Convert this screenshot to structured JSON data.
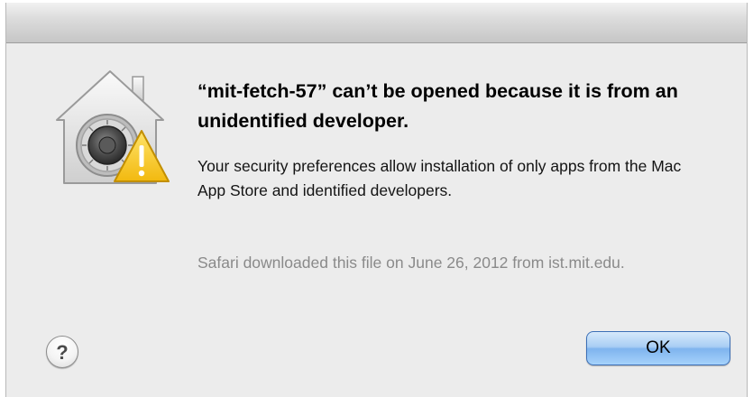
{
  "dialog": {
    "heading": "“mit-fetch-57” can’t be opened because it is from an unidentified developer.",
    "body": "Your security preferences allow installation of only apps from the Mac App Store and identified developers.",
    "source_note": "Safari downloaded this file on June 26, 2012 from ist.mit.edu.",
    "icon": "gatekeeper-security-icon",
    "warning_icon": "warning-icon",
    "help_glyph": "?",
    "help_icon": "help-icon",
    "ok_label": "OK",
    "accent_color": "#7fb4ee",
    "warning_color": "#f5c518"
  }
}
